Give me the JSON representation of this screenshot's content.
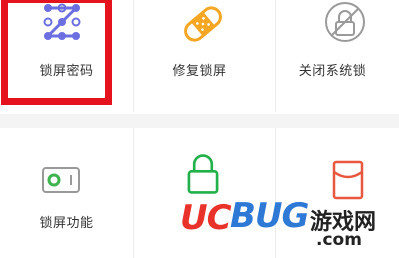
{
  "grid": {
    "row1": [
      {
        "label": "锁屏密码",
        "icon": "pattern-lock-icon"
      },
      {
        "label": "修复锁屏",
        "icon": "bandage-icon"
      },
      {
        "label": "关闭系统锁",
        "icon": "lock-disabled-icon"
      }
    ],
    "row2": [
      {
        "label": "锁屏功能",
        "icon": "toggle-switch-icon"
      },
      {
        "label": "",
        "icon": "padlock-icon"
      },
      {
        "label": "",
        "icon": "red-envelope-icon"
      }
    ]
  },
  "colors": {
    "highlight": "#e5131e",
    "pattern": "#6b6fe0",
    "bandage": "#f5a623",
    "lock_disabled": "#9a9a9a",
    "toggle": "#3fb34f",
    "padlock": "#22b04a",
    "envelope": "#e8583f"
  },
  "watermark": {
    "brand_uc": "UC",
    "brand_bug": "BUG",
    "cn": "游戏网",
    "domain": ".com"
  }
}
